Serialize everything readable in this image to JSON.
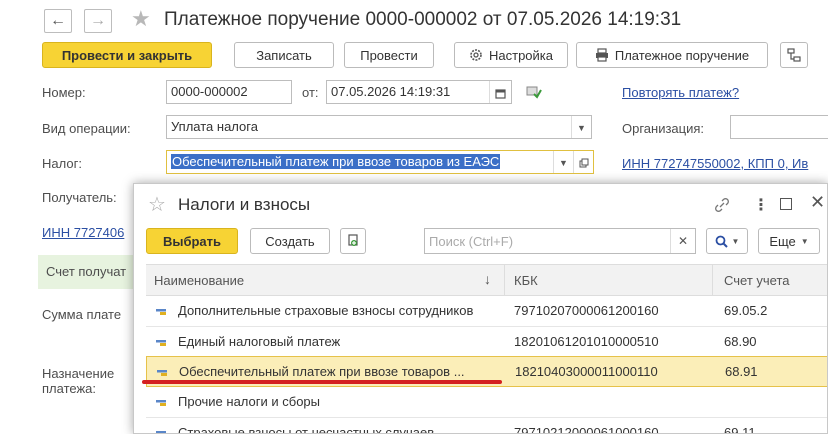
{
  "window": {
    "title": "Платежное поручение 0000-000002 от 07.05.2026 14:19:31"
  },
  "toolbar": {
    "post_close": "Провести и закрыть",
    "save": "Записать",
    "post": "Провести",
    "settings": "Настройка",
    "payment_order": "Платежное поручение"
  },
  "form": {
    "number_label": "Номер:",
    "number_value": "0000-000002",
    "date_label": "от:",
    "date_value": "07.05.2026 14:19:31",
    "repeat_link": "Повторять платеж?",
    "operation_label": "Вид операции:",
    "operation_value": "Уплата налога",
    "organization_label": "Организация:",
    "tax_label": "Налог:",
    "tax_value": "Обеспечительный платеж при ввозе товаров из ЕАЭС",
    "inn_link": "ИНН 772747550002, КПП 0, Ив",
    "recipient_label": "Получатель:",
    "recipient_inn": "ИНН 7727406",
    "recipient_account": "Счет получат",
    "sum_label": "Сумма плате",
    "purpose_label": "Назначение платежа:"
  },
  "dialog": {
    "title": "Налоги и взносы",
    "select_button": "Выбрать",
    "create_button": "Создать",
    "search_placeholder": "Поиск (Ctrl+F)",
    "more_button": "Еще",
    "columns": {
      "name": "Наименование",
      "kbk": "КБК",
      "account": "Счет учета"
    },
    "rows": [
      {
        "name": "Дополнительные страховые взносы сотрудников",
        "kbk": "79710207000061200160",
        "account": "69.05.2"
      },
      {
        "name": "Единый налоговый платеж",
        "kbk": "18201061201010000510",
        "account": "68.90"
      },
      {
        "name": "Обеспечительный платеж при ввозе товаров ...",
        "kbk": "18210403000011000110",
        "account": "68.91"
      },
      {
        "name": "Прочие налоги и сборы",
        "kbk": "",
        "account": ""
      },
      {
        "name": "Страховые взносы от несчастных случаев",
        "kbk": "79710212000061000160",
        "account": "69.11"
      }
    ]
  },
  "colors": {
    "primary_button": "#f7d334",
    "link": "#2b4fa3",
    "selected_row": "#fbeeb8",
    "highlight_text_bg": "#3b6fc7",
    "red_underline": "#d42020"
  }
}
